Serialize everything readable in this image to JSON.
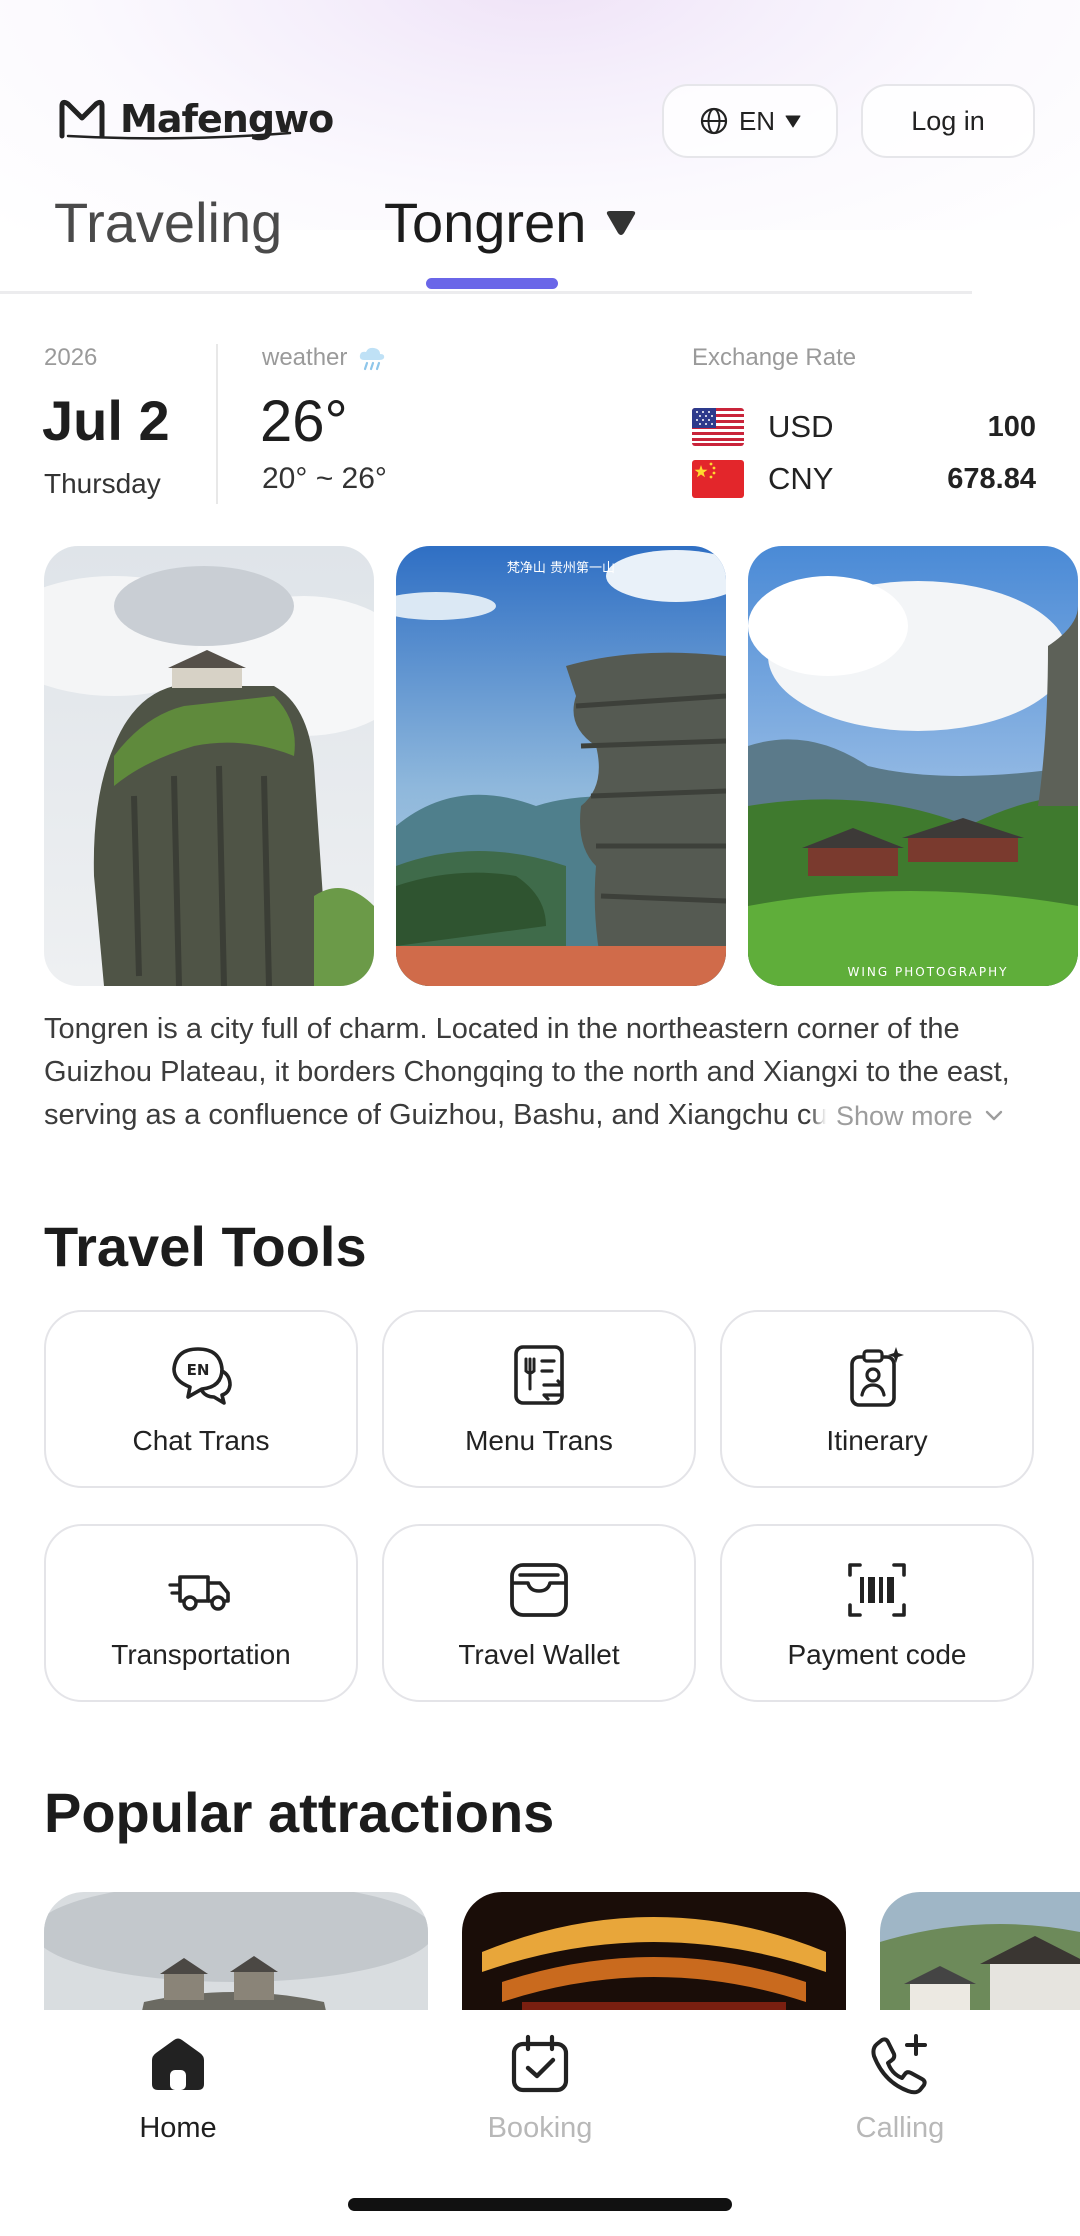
{
  "header": {
    "logo_text": "Mafengwo",
    "language": "EN",
    "login_label": "Log in"
  },
  "tabs": [
    {
      "label": "Traveling",
      "active": false
    },
    {
      "label": "Tongren",
      "active": true
    }
  ],
  "date": {
    "year": "2026",
    "month_day": "Jul 2",
    "weekday": "Thursday"
  },
  "weather": {
    "label": "weather",
    "icon": "rain-cloud-icon",
    "current": "26°",
    "range": "20° ~ 26°"
  },
  "exchange": {
    "label": "Exchange Rate",
    "rows": [
      {
        "flag": "us-flag-icon",
        "code": "USD",
        "value": "100"
      },
      {
        "flag": "cn-flag-icon",
        "code": "CNY",
        "value": "678.84"
      }
    ]
  },
  "photos": [
    {
      "caption": ""
    },
    {
      "caption": "梵净山 贵州第一山"
    },
    {
      "caption": "WING PHOTOGRAPHY"
    }
  ],
  "description": {
    "text": "Tongren is a city full of charm. Located in the northeastern corner of the Guizhou Plateau, it borders Chongqing to the north and Xiangxi to the east, serving as a confluence of Guizhou, Bashu, and Xiangchu cultures.",
    "show_more": "Show more"
  },
  "travel_tools": {
    "title": "Travel Tools",
    "items": [
      {
        "label": "Chat Trans",
        "icon": "chat-translate-icon"
      },
      {
        "label": "Menu Trans",
        "icon": "menu-translate-icon"
      },
      {
        "label": "Itinerary",
        "icon": "itinerary-icon"
      },
      {
        "label": "Transportation",
        "icon": "truck-icon"
      },
      {
        "label": "Travel Wallet",
        "icon": "wallet-icon"
      },
      {
        "label": "Payment code",
        "icon": "barcode-icon"
      }
    ]
  },
  "popular": {
    "title": "Popular attractions"
  },
  "bottom_nav": [
    {
      "label": "Home",
      "icon": "home-icon",
      "active": true
    },
    {
      "label": "Booking",
      "icon": "calendar-check-icon",
      "active": false
    },
    {
      "label": "Calling",
      "icon": "phone-plus-icon",
      "active": false
    }
  ],
  "colors": {
    "accent": "#6a66e8",
    "text_primary": "#1f1f1f",
    "text_muted": "#9a9a9a"
  }
}
